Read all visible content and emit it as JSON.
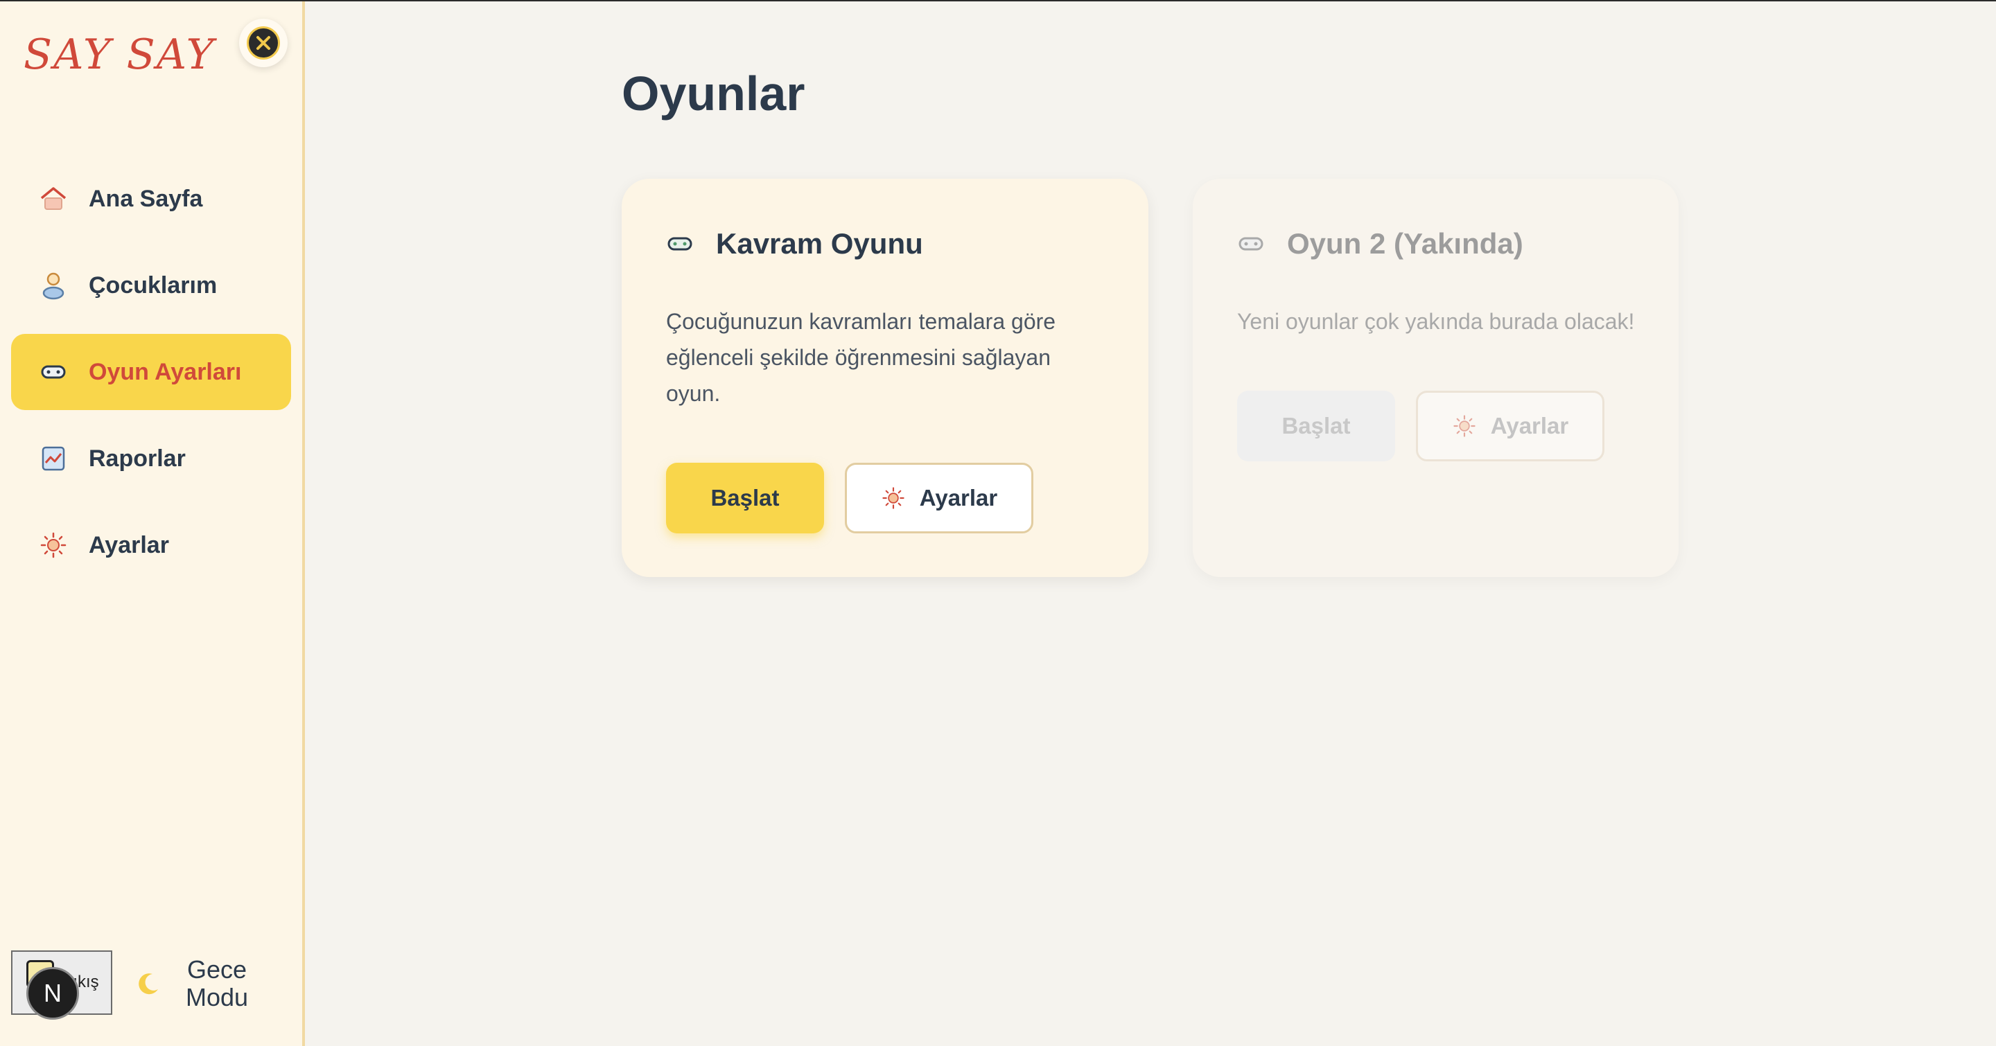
{
  "app": {
    "logo": "SAY SAY"
  },
  "sidebar": {
    "items": [
      {
        "label": "Ana Sayfa",
        "icon": "home-icon"
      },
      {
        "label": "Çocuklarım",
        "icon": "child-icon"
      },
      {
        "label": "Oyun Ayarları",
        "icon": "gamepad-icon",
        "active": true
      },
      {
        "label": "Raporlar",
        "icon": "chart-icon"
      },
      {
        "label": "Ayarlar",
        "icon": "sun-gear-icon"
      }
    ],
    "logout_label": "Çıkış",
    "night_mode_label_1": "Gece",
    "night_mode_label_2": "Modu",
    "badge_letter": "N"
  },
  "main": {
    "title": "Oyunlar",
    "cards": [
      {
        "title": "Kavram Oyunu",
        "description": "Çocuğunuzun kavramları temalara göre eğlenceli şekilde öğrenmesini sağlayan oyun.",
        "start_label": "Başlat",
        "settings_label": "Ayarlar",
        "enabled": true
      },
      {
        "title": "Oyun 2 (Yakında)",
        "description": "Yeni oyunlar çok yakında burada olacak!",
        "start_label": "Başlat",
        "settings_label": "Ayarlar",
        "enabled": false
      }
    ]
  },
  "colors": {
    "accent_yellow": "#f9d64b",
    "accent_red": "#d0493a",
    "text_dark": "#2c3a4b",
    "sidebar_bg": "#fdf6e7",
    "page_bg": "#f5f3ee"
  }
}
